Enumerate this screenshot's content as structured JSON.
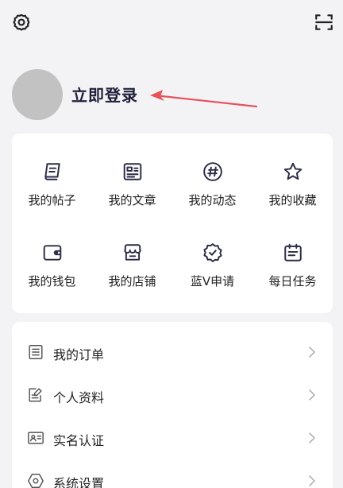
{
  "header": {
    "settings_icon": "gear-icon",
    "scan_icon": "scan-icon"
  },
  "profile": {
    "login_label": "立即登录"
  },
  "colors": {
    "background": "#f3f3f5",
    "card": "#ffffff",
    "icon_stroke": "#2b2b45",
    "arrow": "#e8505b",
    "avatar": "#c2c2c2"
  },
  "grid": {
    "items": [
      {
        "label": "我的帖子",
        "icon": "post-icon"
      },
      {
        "label": "我的文章",
        "icon": "article-icon"
      },
      {
        "label": "我的动态",
        "icon": "hashtag-icon"
      },
      {
        "label": "我的收藏",
        "icon": "star-icon"
      },
      {
        "label": "我的钱包",
        "icon": "wallet-icon"
      },
      {
        "label": "我的店铺",
        "icon": "store-icon"
      },
      {
        "label": "蓝V申请",
        "icon": "verified-badge-icon"
      },
      {
        "label": "每日任务",
        "icon": "calendar-icon"
      }
    ]
  },
  "list": {
    "items": [
      {
        "label": "我的订单",
        "icon": "order-list-icon"
      },
      {
        "label": "个人资料",
        "icon": "profile-edit-icon"
      },
      {
        "label": "实名认证",
        "icon": "id-card-icon"
      },
      {
        "label": "系统设置",
        "icon": "system-settings-icon"
      }
    ]
  }
}
